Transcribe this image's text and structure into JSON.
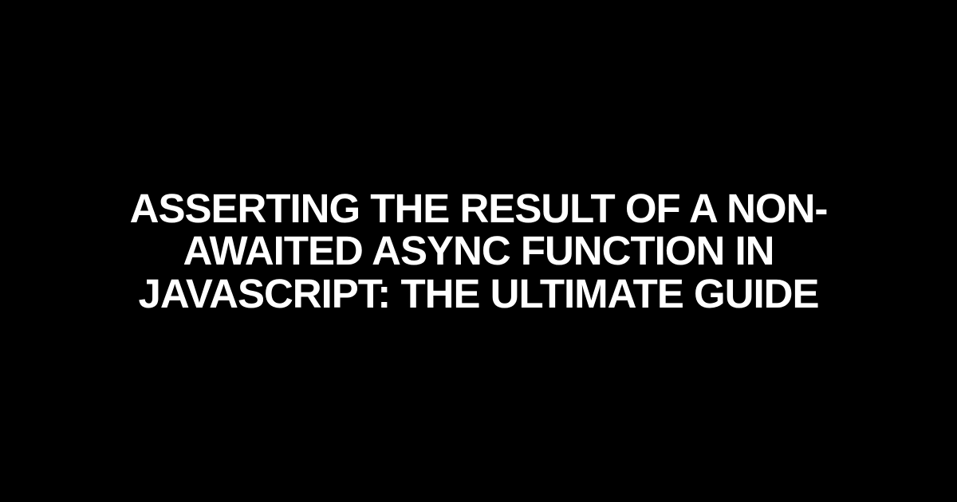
{
  "title": "Asserting the Result of a Non-Awaited Async Function in JavaScript: The Ultimate Guide"
}
